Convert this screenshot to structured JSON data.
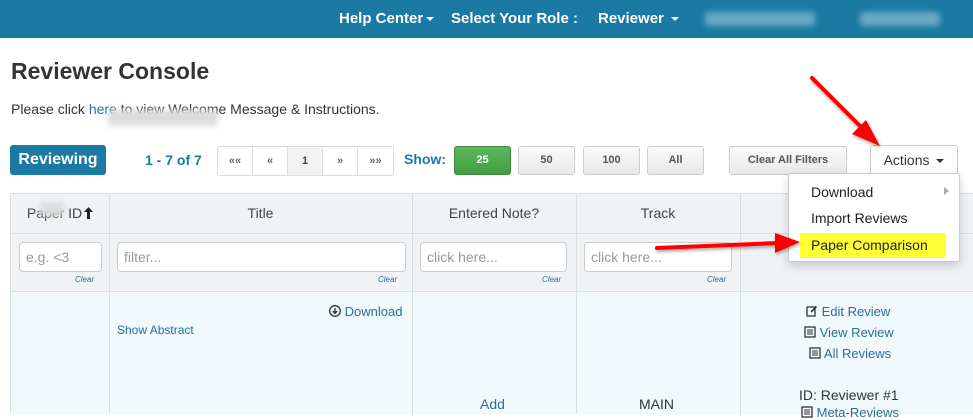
{
  "topnav": {
    "help_center": "Help Center",
    "select_role": "Select Your Role :",
    "role": "Reviewer"
  },
  "page": {
    "title": "Reviewer Console",
    "welcome_prefix": "Please click ",
    "welcome_link": "here",
    "welcome_suffix": " to view Welcome Message & Instructions."
  },
  "toolbar": {
    "reviewing": "Reviewing",
    "range": "1 - 7 of 7",
    "pager": [
      "««",
      "«",
      "1",
      "»",
      "»»"
    ],
    "show_label": "Show:",
    "show_options": [
      "25",
      "50",
      "100",
      "All"
    ],
    "clear_filters": "Clear All Filters",
    "actions": "Actions"
  },
  "table": {
    "headers": {
      "paper_id": "Paper ID",
      "title": "Title",
      "entered_note": "Entered Note?",
      "track": "Track"
    },
    "filters": {
      "paper_id_placeholder": "e.g. <3",
      "title_placeholder": "filter...",
      "note_placeholder": "click here...",
      "track_placeholder": "click here...",
      "clear": "Clear"
    },
    "row": {
      "download": "Download",
      "show_abstract": "Show Abstract",
      "add": "Add",
      "track": "MAIN",
      "edit_review": "Edit Review",
      "view_review": "View Review",
      "all_reviews": "All Reviews",
      "reviewer_id": "ID: Reviewer #1",
      "meta_reviews": "Meta-Reviews"
    }
  },
  "dropdown": {
    "items": [
      "Download",
      "Import Reviews",
      "Paper Comparison"
    ],
    "highlight_color": "#ffff33"
  },
  "colors": {
    "brand": "#1b7aa3",
    "link": "#2a6f97",
    "active_green": "#5cb85c",
    "annotation_arrow": "#ff0000"
  }
}
